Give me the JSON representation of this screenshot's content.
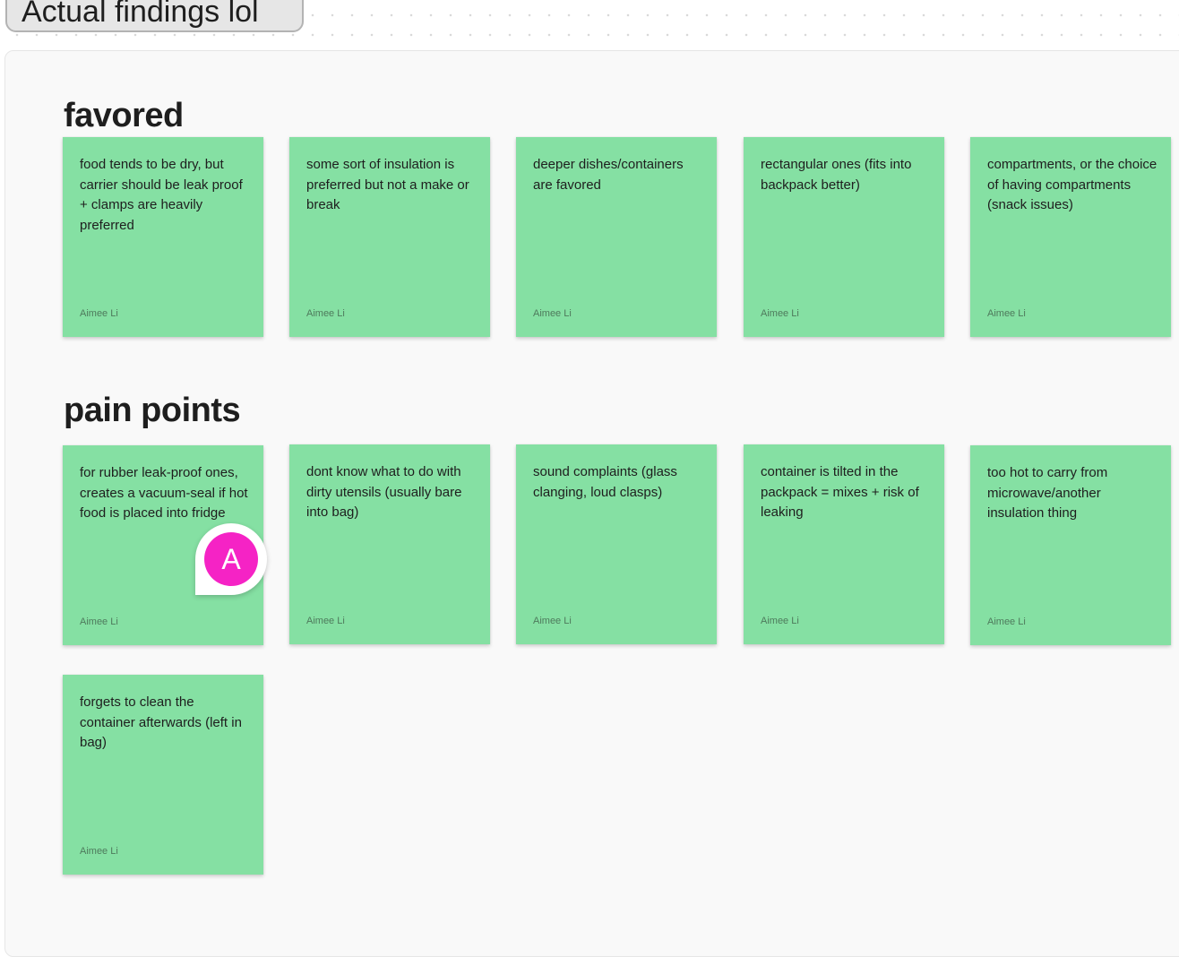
{
  "section": {
    "title": "Actual findings lol"
  },
  "groups": [
    {
      "heading": "favored",
      "notes": [
        {
          "text": "food tends to be dry, but carrier should be leak proof + clamps are heavily preferred",
          "author": "Aimee Li"
        },
        {
          "text": "some sort of insulation is preferred but not a make or break",
          "author": "Aimee Li"
        },
        {
          "text": "deeper dishes/containers are favored",
          "author": "Aimee Li"
        },
        {
          "text": "rectangular ones (fits into backpack better)",
          "author": "Aimee Li"
        },
        {
          "text": "compartments, or the choice of having compartments (snack issues)",
          "author": "Aimee Li"
        }
      ]
    },
    {
      "heading": "pain points",
      "notes": [
        {
          "text": "for rubber leak-proof ones, creates a vacuum-seal if hot food is placed into fridge",
          "author": "Aimee Li"
        },
        {
          "text": "dont know what to do with dirty utensils (usually bare into bag)",
          "author": "Aimee Li"
        },
        {
          "text": "sound complaints (glass clanging, loud clasps)",
          "author": "Aimee Li"
        },
        {
          "text": "container is tilted in the packpack = mixes + risk of leaking",
          "author": "Aimee Li"
        },
        {
          "text": "too hot to carry from microwave/another insulation thing",
          "author": "Aimee Li"
        },
        {
          "text": "forgets to clean the container afterwards (left in bag)",
          "author": "Aimee Li"
        }
      ]
    }
  ],
  "collaborator_cursor": {
    "initial": "A",
    "color": "#f523c5"
  },
  "colors": {
    "sticky": "#85e0a3",
    "canvas": "#f9f9f9"
  }
}
